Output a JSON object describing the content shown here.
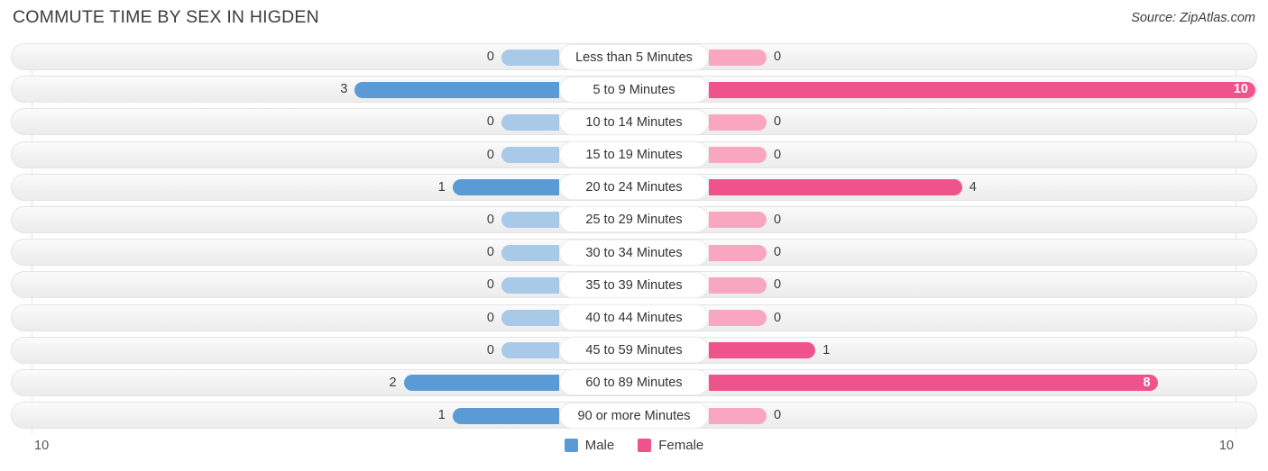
{
  "header": {
    "title": "COMMUTE TIME BY SEX IN HIGDEN",
    "source": "Source: ZipAtlas.com"
  },
  "legend": {
    "male_label": "Male",
    "female_label": "Female",
    "male_color": "#5b9bd5",
    "female_color": "#f0528c"
  },
  "axis": {
    "left_tick": "10",
    "right_tick": "10",
    "max": 10
  },
  "chart_data": {
    "type": "bar",
    "title": "COMMUTE TIME BY SEX IN HIGDEN",
    "subtitle": "Source: ZipAtlas.com",
    "orientation": "horizontal",
    "layout": "diverging-bidirectional",
    "xlabel": "",
    "ylabel": "",
    "xlim": [
      10,
      10
    ],
    "grid": false,
    "legend_position": "bottom-center",
    "categories": [
      "Less than 5 Minutes",
      "5 to 9 Minutes",
      "10 to 14 Minutes",
      "15 to 19 Minutes",
      "20 to 24 Minutes",
      "25 to 29 Minutes",
      "30 to 34 Minutes",
      "35 to 39 Minutes",
      "40 to 44 Minutes",
      "45 to 59 Minutes",
      "60 to 89 Minutes",
      "90 or more Minutes"
    ],
    "series": [
      {
        "name": "Male",
        "color": "#5b9bd5",
        "direction": "left",
        "values": [
          0,
          3,
          0,
          0,
          1,
          0,
          0,
          0,
          0,
          0,
          2,
          1
        ]
      },
      {
        "name": "Female",
        "color": "#f0528c",
        "direction": "right",
        "values": [
          0,
          10,
          0,
          0,
          4,
          0,
          0,
          0,
          0,
          1,
          8,
          0
        ]
      }
    ]
  },
  "rows": [
    {
      "label": "Less than 5 Minutes",
      "male": "0",
      "female": "0"
    },
    {
      "label": "5 to 9 Minutes",
      "male": "3",
      "female": "10"
    },
    {
      "label": "10 to 14 Minutes",
      "male": "0",
      "female": "0"
    },
    {
      "label": "15 to 19 Minutes",
      "male": "0",
      "female": "0"
    },
    {
      "label": "20 to 24 Minutes",
      "male": "1",
      "female": "4"
    },
    {
      "label": "25 to 29 Minutes",
      "male": "0",
      "female": "0"
    },
    {
      "label": "30 to 34 Minutes",
      "male": "0",
      "female": "0"
    },
    {
      "label": "35 to 39 Minutes",
      "male": "0",
      "female": "0"
    },
    {
      "label": "40 to 44 Minutes",
      "male": "0",
      "female": "0"
    },
    {
      "label": "45 to 59 Minutes",
      "male": "0",
      "female": "1"
    },
    {
      "label": "60 to 89 Minutes",
      "male": "2",
      "female": "8"
    },
    {
      "label": "90 or more Minutes",
      "male": "1",
      "female": "0"
    }
  ]
}
